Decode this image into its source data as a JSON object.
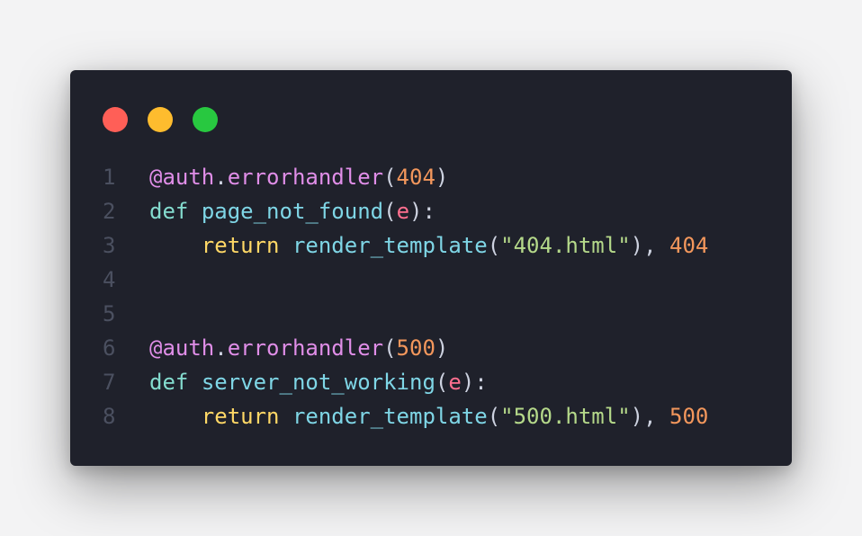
{
  "window": {
    "controls": [
      {
        "name": "close",
        "color": "#ff5f57"
      },
      {
        "name": "minimize",
        "color": "#febc2e"
      },
      {
        "name": "maximize",
        "color": "#28c840"
      }
    ]
  },
  "code": {
    "language": "python",
    "lines": [
      {
        "number": "1",
        "tokens": [
          {
            "text": "@auth",
            "type": "decorator"
          },
          {
            "text": ".",
            "type": "punct"
          },
          {
            "text": "errorhandler",
            "type": "decorator"
          },
          {
            "text": "(",
            "type": "punct"
          },
          {
            "text": "404",
            "type": "number"
          },
          {
            "text": ")",
            "type": "punct"
          }
        ]
      },
      {
        "number": "2",
        "tokens": [
          {
            "text": "def",
            "type": "keyword"
          },
          {
            "text": " ",
            "type": "punct"
          },
          {
            "text": "page_not_found",
            "type": "func"
          },
          {
            "text": "(",
            "type": "punct"
          },
          {
            "text": "e",
            "type": "param"
          },
          {
            "text": "):",
            "type": "punct"
          }
        ]
      },
      {
        "number": "3",
        "tokens": [
          {
            "text": "    ",
            "type": "punct"
          },
          {
            "text": "return",
            "type": "return"
          },
          {
            "text": " ",
            "type": "punct"
          },
          {
            "text": "render_template",
            "type": "func"
          },
          {
            "text": "(",
            "type": "punct"
          },
          {
            "text": "\"404.html\"",
            "type": "string"
          },
          {
            "text": "), ",
            "type": "punct"
          },
          {
            "text": "404",
            "type": "number"
          }
        ]
      },
      {
        "number": "4",
        "tokens": []
      },
      {
        "number": "5",
        "tokens": []
      },
      {
        "number": "6",
        "tokens": [
          {
            "text": "@auth",
            "type": "decorator"
          },
          {
            "text": ".",
            "type": "punct"
          },
          {
            "text": "errorhandler",
            "type": "decorator"
          },
          {
            "text": "(",
            "type": "punct"
          },
          {
            "text": "500",
            "type": "number"
          },
          {
            "text": ")",
            "type": "punct"
          }
        ]
      },
      {
        "number": "7",
        "tokens": [
          {
            "text": "def",
            "type": "keyword"
          },
          {
            "text": " ",
            "type": "punct"
          },
          {
            "text": "server_not_working",
            "type": "func"
          },
          {
            "text": "(",
            "type": "punct"
          },
          {
            "text": "e",
            "type": "param"
          },
          {
            "text": "):",
            "type": "punct"
          }
        ]
      },
      {
        "number": "8",
        "tokens": [
          {
            "text": "    ",
            "type": "punct"
          },
          {
            "text": "return",
            "type": "return"
          },
          {
            "text": " ",
            "type": "punct"
          },
          {
            "text": "render_template",
            "type": "func"
          },
          {
            "text": "(",
            "type": "punct"
          },
          {
            "text": "\"500.html\"",
            "type": "string"
          },
          {
            "text": "), ",
            "type": "punct"
          },
          {
            "text": "500",
            "type": "number"
          }
        ]
      }
    ]
  }
}
